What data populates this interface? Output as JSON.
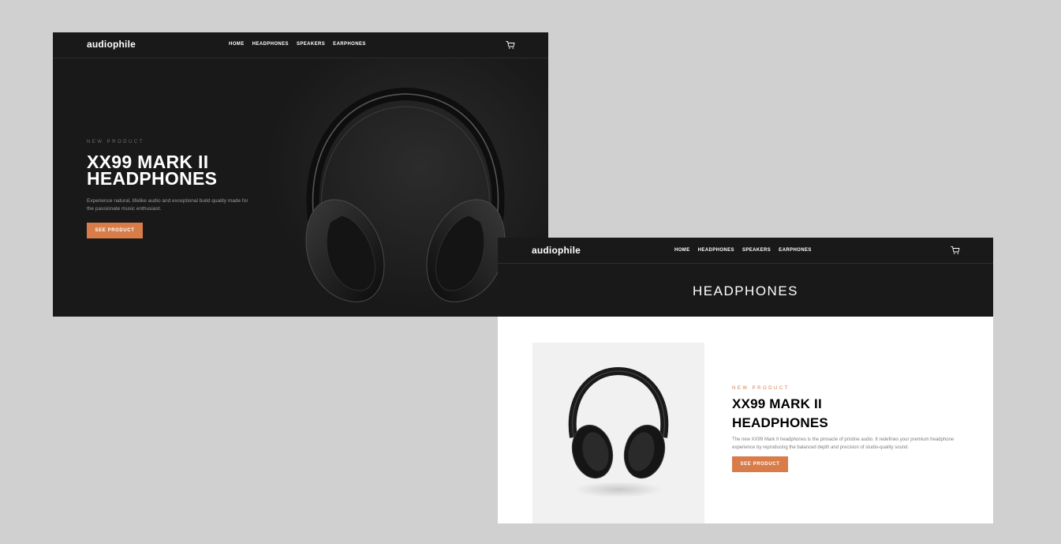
{
  "brand": "audiophile",
  "nav": {
    "home": "HOME",
    "headphones": "HEADPHONES",
    "speakers": "SPEAKERS",
    "earphones": "EARPHONES"
  },
  "hero": {
    "eyebrow": "NEW PRODUCT",
    "title_line1": "XX99 MARK II",
    "title_line2": "HEADPHONES",
    "description": "Experience natural, lifelike audio and exceptional build quality made for the passionate music enthusiast.",
    "cta": "SEE PRODUCT"
  },
  "category": {
    "title": "HEADPHONES",
    "product": {
      "eyebrow": "NEW PRODUCT",
      "title_line1": "XX99 MARK II",
      "title_line2": "HEADPHONES",
      "description": "The new XX99 Mark II headphones is the pinnacle of pristine audio. It redefines your premium headphone experience by reproducing the balanced depth and precision of studio-quality sound.",
      "cta": "SEE PRODUCT"
    }
  },
  "colors": {
    "accent": "#d87d4a",
    "dark": "#191919",
    "background": "#d0d0d0",
    "light_panel": "#f1f1f1"
  },
  "icons": {
    "cart": "cart-icon"
  }
}
